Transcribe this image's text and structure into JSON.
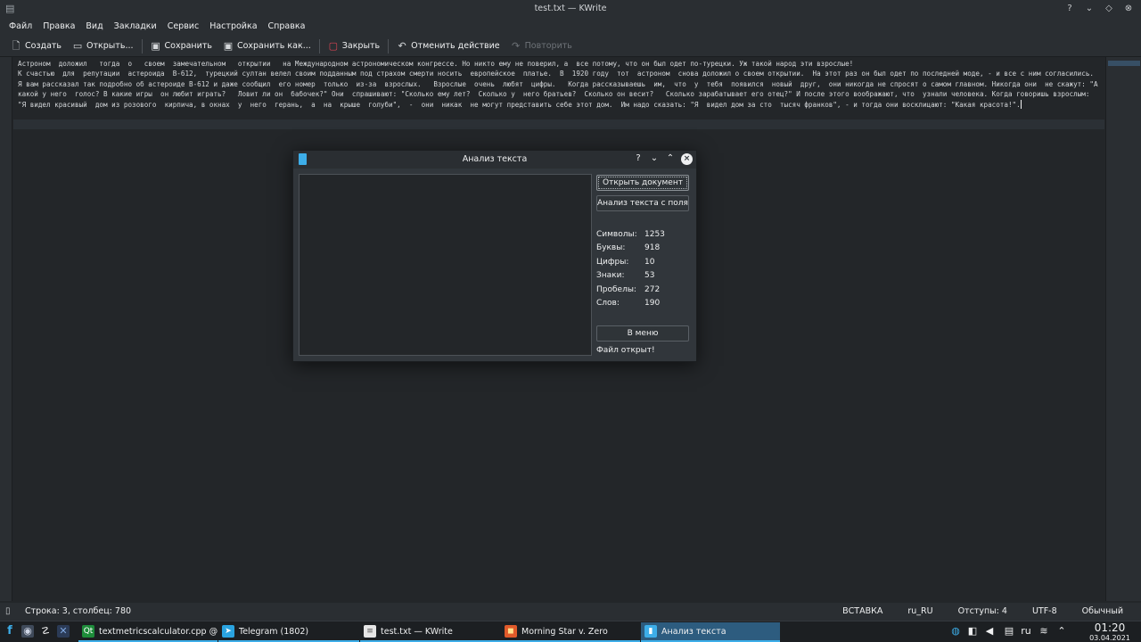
{
  "window": {
    "title": "test.txt — KWrite",
    "buttons": [
      "?",
      "⌄",
      "◇",
      "⊗"
    ]
  },
  "menu": [
    "Файл",
    "Правка",
    "Вид",
    "Закладки",
    "Сервис",
    "Настройка",
    "Справка"
  ],
  "toolbar": {
    "new_label": "Создать",
    "open_label": "Открыть...",
    "save_label": "Сохранить",
    "save_as_label": "Сохранить как...",
    "close_label": "Закрыть",
    "undo_label": "Отменить действие",
    "redo_label": "Повторить"
  },
  "editor": {
    "text": "Астроном  доложил   тогда  о   своем  замечательном   открытии   на Международном астрономическом конгрессе. Но никто ему не поверил, а  все потому, что он был одет по-турецки. Уж такой народ эти взрослые!\nК счастью  для  репутации  астероида  B-612,  турецкий султан велел своим подданным под страхом смерти носить  европейское  платье.  В  1920 году  тот  астроном  снова доложил о своем открытии.  На этот раз он был одет по последней моде, - и все с ним согласились.\nЯ вам рассказал так подробно об астероиде B-612 и даже сообщил  его номер  только  из-за  взрослых.   Взрослые  очень  любят  цифры.   Когда рассказываешь  им,  что  у  тебя  появился  новый  друг,  они никогда не спросят о самом главном. Никогда они  не скажут: \"А какой у него  голос? В какие игры  он любит играть?   Ловит ли он  бабочек?\" Они  спрашивают: \"Сколько ему лет?  Сколько у  него братьев?  Сколько он весит?   Сколько зарабатывает его отец?\" И после этого воображают, что  узнали человека. Когда говоришь взрослым:  \"Я видел красивый  дом из розового  кирпича, в окнах  у  него  герань,  а  на  крыше  голуби\",  -  они  никак  не могут представить себе этот дом.  Им надо сказать: \"Я  видел дом за сто  тысяч франков\", - и тогда они восклицают: \"Какая красота!\"."
  },
  "statusbar": {
    "position": "Строка: 3, столбец: 780",
    "mode": "ВСТАВКА",
    "language": "ru_RU",
    "indent": "Отступы: 4",
    "encoding": "UTF-8",
    "highlight": "Обычный"
  },
  "dialog": {
    "title": "Анализ текста",
    "help": "?",
    "open_doc_label": "Открыть документ",
    "analyze_label": "Анализ текста с поля",
    "stats": [
      {
        "label": "Символы:",
        "value": "1253"
      },
      {
        "label": "Буквы:",
        "value": "918"
      },
      {
        "label": "Цифры:",
        "value": "10"
      },
      {
        "label": "Знаки:",
        "value": "53"
      },
      {
        "label": "Пробелы:",
        "value": "272"
      },
      {
        "label": "Слов:",
        "value": "190"
      }
    ],
    "menu_label": "В меню",
    "status": "Файл открыт!"
  },
  "taskbar": {
    "tasks": [
      {
        "label": "textmetricscalculator.cpp @ ...",
        "icon_color": "#1e8c3a"
      },
      {
        "label": "Telegram (1802)",
        "icon_color": "#2aa3e0"
      },
      {
        "label": "test.txt  — KWrite",
        "icon_color": "#e6e6e6"
      },
      {
        "label": "Morning Star v. Zero",
        "icon_color": "#e05a2a"
      },
      {
        "label": "Анализ текста",
        "icon_color": "#3daee9"
      }
    ],
    "keyboard": "ru",
    "time": "01:20",
    "date": "03.04.2021"
  },
  "colors": {
    "accent": "#3daee9",
    "background": "#232629",
    "panel": "#2a2e32"
  }
}
